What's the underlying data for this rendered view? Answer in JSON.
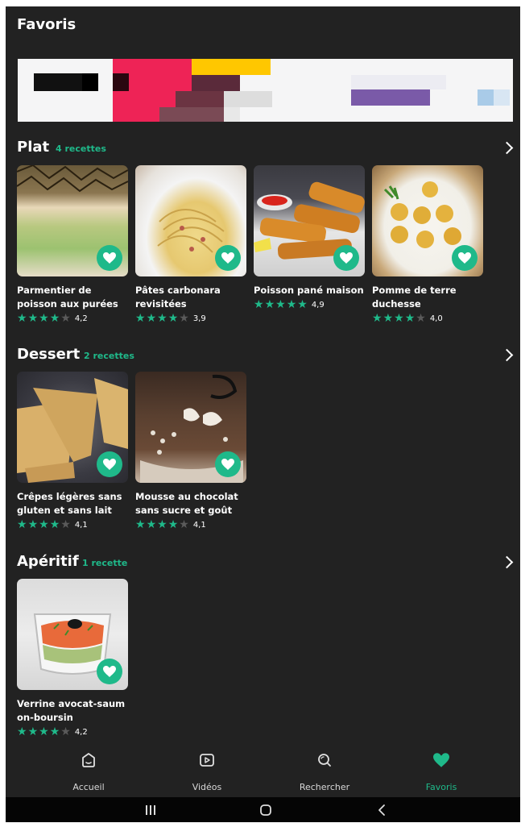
{
  "page": {
    "title": "Favoris"
  },
  "sections": [
    {
      "title": "Plat",
      "count": "4 recettes",
      "recipes": [
        {
          "name": "Parmentier de poisson aux purées ...",
          "rating": "4,2",
          "stars": 4
        },
        {
          "name": "Pâtes carbonara revisitées",
          "rating": "3,9",
          "stars": 4
        },
        {
          "name": "Poisson pané maison",
          "rating": "4,9",
          "stars": 5
        },
        {
          "name": "Pomme de terre duchesse",
          "rating": "4,0",
          "stars": 4
        }
      ]
    },
    {
      "title": "Dessert",
      "count": "2 recettes",
      "recipes": [
        {
          "name": "Crêpes légères sans gluten et sans lait de...",
          "rating": "4,1",
          "stars": 4
        },
        {
          "name": "Mousse au chocolat sans sucre et goût c...",
          "rating": "4,1",
          "stars": 4
        }
      ]
    },
    {
      "title": "Apéritif",
      "count": "1 recette",
      "recipes": [
        {
          "name": "Verrine avocat-saum on-boursin",
          "rating": "4,2",
          "stars": 4
        }
      ]
    }
  ],
  "nav": {
    "items": [
      {
        "label": "Accueil",
        "icon": "home-icon"
      },
      {
        "label": "Vidéos",
        "icon": "video-icon"
      },
      {
        "label": "Rechercher",
        "icon": "search-icon"
      },
      {
        "label": "Favoris",
        "icon": "heart-icon",
        "active": true
      }
    ]
  },
  "colors": {
    "accent": "#1fb98a",
    "background": "#222222",
    "banner_pink": "#ee2356",
    "banner_yellow": "#ffc700",
    "banner_purple": "#7a5aa8"
  }
}
